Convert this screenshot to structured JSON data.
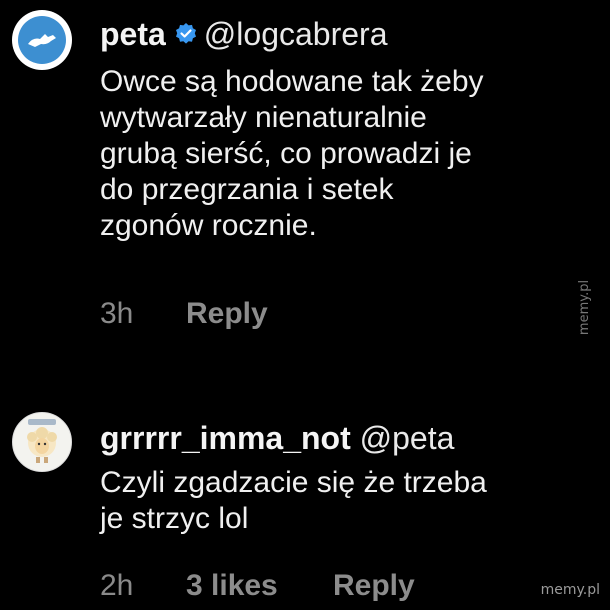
{
  "comments": [
    {
      "username": "peta",
      "mention": "@logcabrera",
      "text_lines": [
        "Owce są hodowane tak żeby",
        "wytwarzały nienaturalnie",
        "grubą sierść, co prowadzi je",
        "do przegrzania i setek",
        "zgonów rocznie."
      ],
      "time": "3h",
      "reply_label": "Reply",
      "verified": true
    },
    {
      "username": "grrrrr_imma_not",
      "mention": "@peta",
      "text_lines": [
        "Czyli zgadzacie się że trzeba",
        "je strzyc lol"
      ],
      "time": "2h",
      "likes": "3 likes",
      "reply_label": "Reply",
      "verified": false
    }
  ],
  "watermarks": {
    "side": "memy.pl",
    "corner": "memy.pl"
  },
  "colors": {
    "background": "#000000",
    "verified_badge": "#3897f0",
    "meta_text": "#8a8a8a"
  }
}
